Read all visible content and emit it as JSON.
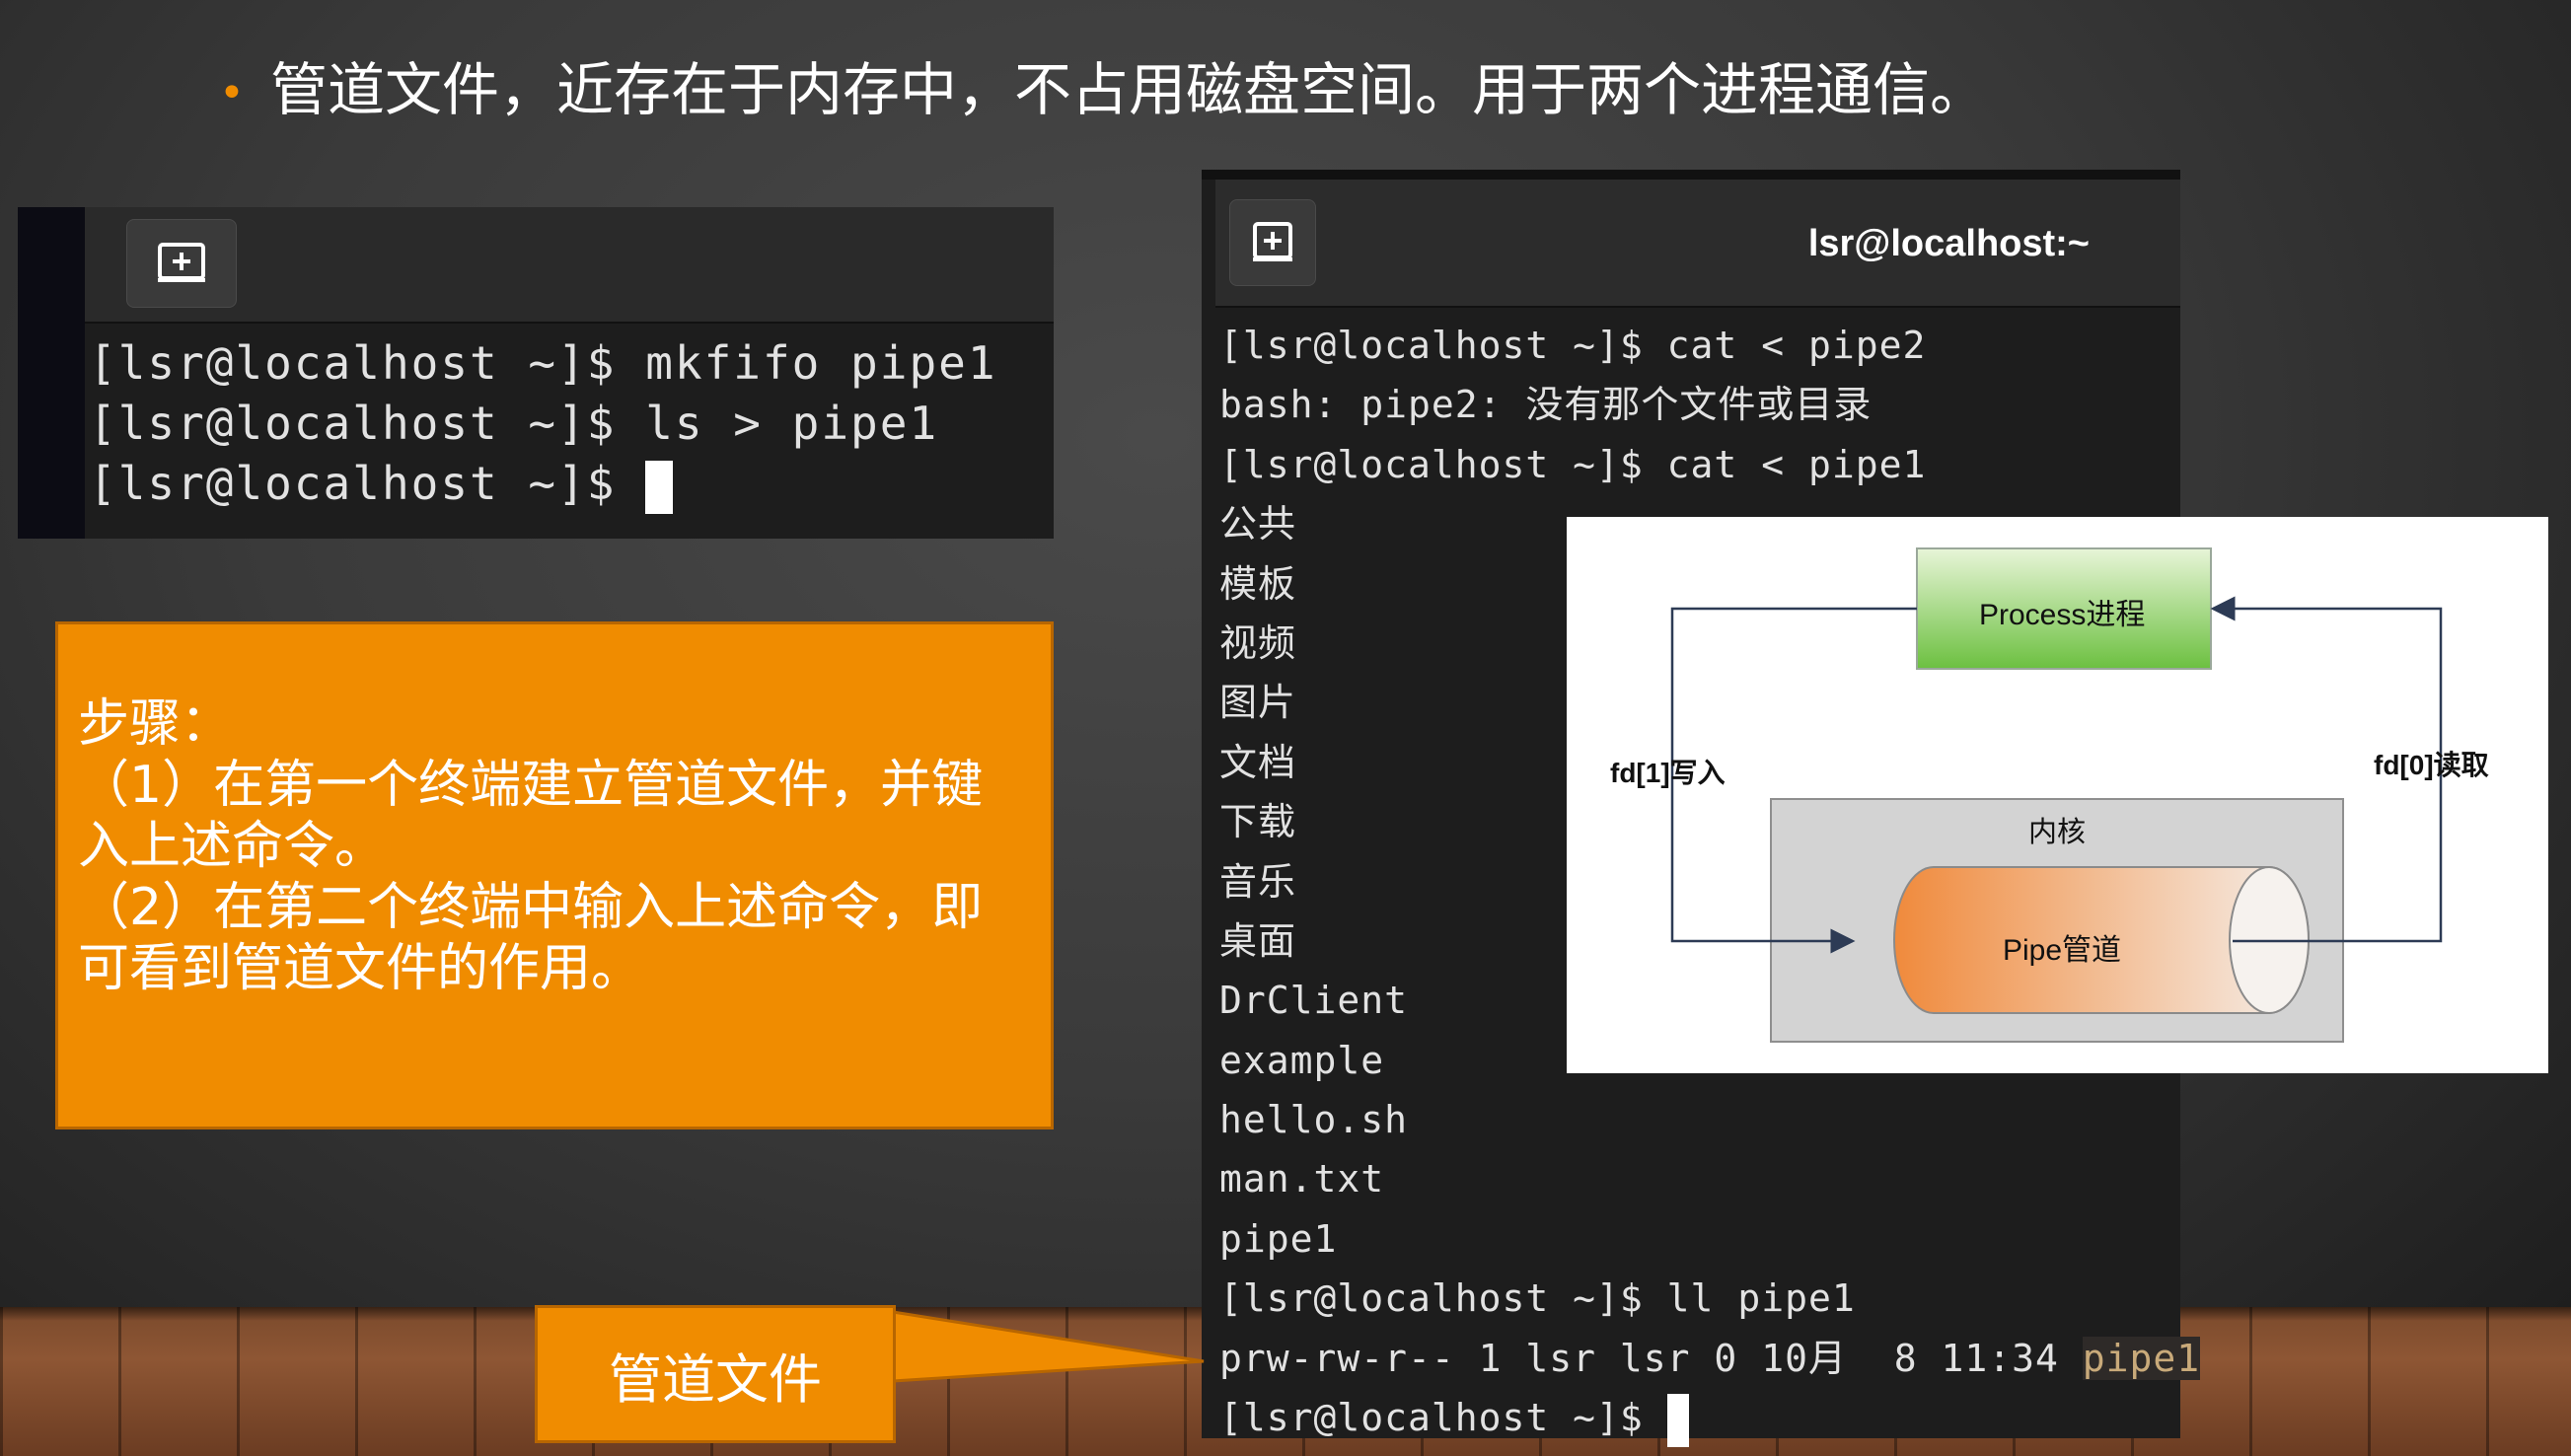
{
  "slide": {
    "bullet": "管道文件，近存在于内存中，不占用磁盘空间。用于两个进程通信。"
  },
  "terminal1": {
    "new_tab_icon": "new-tab-icon",
    "lines": [
      "[lsr@localhost ~]$ mkfifo pipe1",
      "[lsr@localhost ~]$ ls > pipe1",
      "[lsr@localhost ~]$ "
    ]
  },
  "steps": {
    "title": "步骤：",
    "step1": "（1）在第一个终端建立管道文件，并键入上述命令。",
    "step2": "（2）在第二个终端中输入上述命令，即可看到管道文件的作用。"
  },
  "terminal2": {
    "title": "lsr@localhost:~",
    "new_tab_icon": "new-tab-icon",
    "lines": [
      "[lsr@localhost ~]$ cat < pipe2",
      "bash: pipe2: 没有那个文件或目录",
      "[lsr@localhost ~]$ cat < pipe1",
      "公共",
      "模板",
      "视频",
      "图片",
      "文档",
      "下载",
      "音乐",
      "桌面",
      "DrClient",
      "example",
      "hello.sh",
      "man.txt",
      "pipe1",
      "[lsr@localhost ~]$ ll pipe1"
    ],
    "ll_output": "prw-rw-r-- 1 lsr lsr 0 10月  8 11:34 ",
    "ll_output_name": "pipe1",
    "last_prompt": "[lsr@localhost ~]$ "
  },
  "diagram": {
    "process_label": "Process进程",
    "kernel_label": "内核",
    "pipe_label": "Pipe管道",
    "write_label": "fd[1]写入",
    "read_label": "fd[0]读取",
    "colors": {
      "process_top": "#e8f5d8",
      "process_bottom": "#6cc040",
      "pipe_left": "#f08a3c",
      "kernel_bg": "#d3d3d3"
    }
  },
  "callout": {
    "label": "管道文件"
  }
}
